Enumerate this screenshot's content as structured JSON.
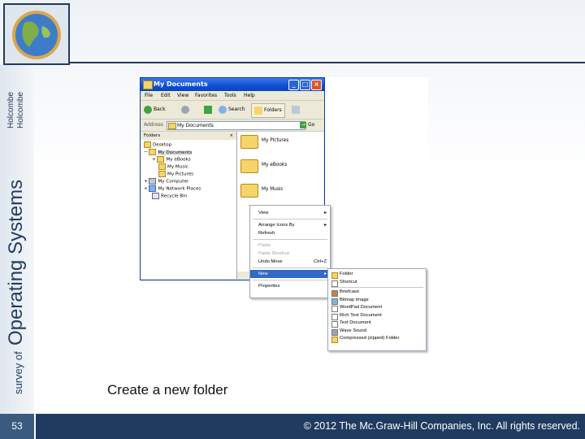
{
  "slide": {
    "book_title": "survey of Operating Systems Holcombe Holcombe",
    "book_title_parts": [
      "survey of",
      "Operating Systems",
      "Holcombe",
      "Holcombe"
    ],
    "caption": "Create a new folder",
    "page_number": "53",
    "copyright": "© 2012 The Mc.Graw-Hill Companies, Inc. All rights reserved."
  },
  "window": {
    "title": "My Documents",
    "caption_buttons": [
      "_",
      "□",
      "×"
    ],
    "menu": [
      "File",
      "Edit",
      "View",
      "Favorites",
      "Tools",
      "Help"
    ],
    "toolbar": {
      "back": "Back",
      "search": "Search",
      "folders": "Folders"
    },
    "address": {
      "label": "Address",
      "value": "My Documents",
      "go": "Go"
    },
    "folders_pane": {
      "title": "Folders",
      "close": "×",
      "tree": [
        {
          "label": "Desktop",
          "indent": 0,
          "expander": ""
        },
        {
          "label": "My Documents",
          "indent": 1,
          "expander": "−",
          "selected": true
        },
        {
          "label": "My eBooks",
          "indent": 2,
          "expander": "+"
        },
        {
          "label": "My Music",
          "indent": 2,
          "expander": ""
        },
        {
          "label": "My Pictures",
          "indent": 2,
          "expander": ""
        },
        {
          "label": "My Computer",
          "indent": 1,
          "expander": "+"
        },
        {
          "label": "My Network Places",
          "indent": 1,
          "expander": "+"
        },
        {
          "label": "Recycle Bin",
          "indent": 1,
          "expander": ""
        }
      ]
    },
    "content_items": [
      "My Pictures",
      "My eBooks",
      "My Music"
    ]
  },
  "context_menu": {
    "items": [
      {
        "label": "View",
        "arrow": "▸"
      },
      {
        "label": "Arrange Icons By",
        "arrow": "▸"
      },
      {
        "label": "Refresh",
        "arrow": ""
      },
      {
        "label": "Paste",
        "arrow": "",
        "disabled": true
      },
      {
        "label": "Paste Shortcut",
        "arrow": "",
        "disabled": true
      },
      {
        "label": "Undo Move",
        "arrow": "",
        "shortcut": "Ctrl+Z"
      },
      {
        "label": "New",
        "arrow": "▸",
        "highlight": true
      },
      {
        "label": "Properties",
        "arrow": ""
      }
    ]
  },
  "new_submenu": {
    "items": [
      "Folder",
      "Shortcut",
      "Briefcase",
      "Bitmap Image",
      "WordPad Document",
      "Rich Text Document",
      "Text Document",
      "Wave Sound",
      "Compressed (zipped) Folder"
    ]
  },
  "colors": {
    "footer": "#1f3b5f",
    "titlebar": "#0e4fd4",
    "menu_highlight": "#316ac5",
    "folder_yellow": "#f6d46a"
  }
}
